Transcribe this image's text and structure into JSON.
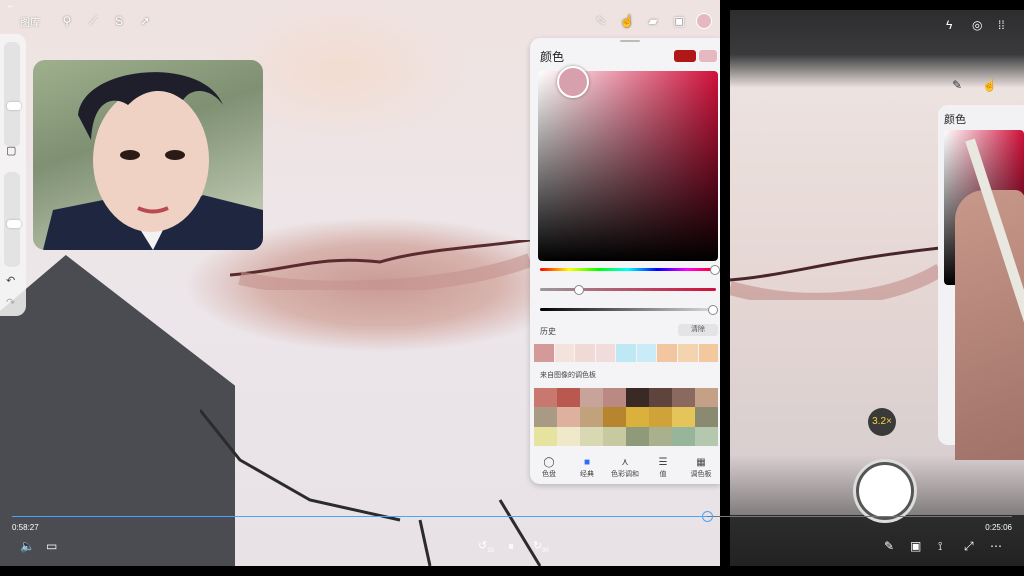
{
  "player": {
    "back_icon": "back-arrow-icon",
    "elapsed": "0:58:27",
    "duration": "0:25:06",
    "progress_fraction": 0.695,
    "skip_back_label": "10",
    "skip_fwd_label": "30",
    "accent": "#4aa3ff"
  },
  "procreate": {
    "gallery_label": "图库",
    "toolbar_icons": [
      "wrench-icon",
      "magic-wand-icon",
      "selection-icon",
      "transform-icon",
      "brush-icon",
      "smudge-icon",
      "eraser-icon",
      "layers-icon",
      "color-icon"
    ],
    "color_panel": {
      "title": "颜色",
      "primary": "#b01818",
      "secondary": "#e6b8bf",
      "history_label": "历史",
      "clear_label": "清除",
      "history_colors": [
        "#d49a99",
        "#f3e3dc",
        "#efdad6",
        "#f1dbdb",
        "#bfe8f5",
        "#c9ecf8",
        "#f3c6a2",
        "#f4d4ae",
        "#f2c99e"
      ],
      "palette_label": "来自图像的调色板",
      "palette_colors": [
        "#c9786f",
        "#b8584f",
        "#c7a39a",
        "#ba8a82",
        "#3a2a26",
        "#5e443c",
        "#8a6a5e",
        "#c3a086",
        "#a89a84",
        "#ddb0a0",
        "#c2a27a",
        "#b8852f",
        "#dbb13d",
        "#cfa23a",
        "#e5c55a",
        "#8a8a70",
        "#e6e2a0",
        "#efe9c9",
        "#d8d9b2",
        "#c7caa0",
        "#8f9a7a",
        "#a8b08e",
        "#97b59a",
        "#b4c8b0"
      ],
      "tabs": [
        {
          "label": "色盘",
          "icon": "disc-icon"
        },
        {
          "label": "经典",
          "icon": "classic-square-icon"
        },
        {
          "label": "色彩调和",
          "icon": "harmony-icon"
        },
        {
          "label": "值",
          "icon": "sliders-icon"
        },
        {
          "label": "调色板",
          "icon": "palette-grid-icon"
        }
      ]
    }
  },
  "camera": {
    "panel_title": "颜色",
    "zoom": "3.2×"
  }
}
